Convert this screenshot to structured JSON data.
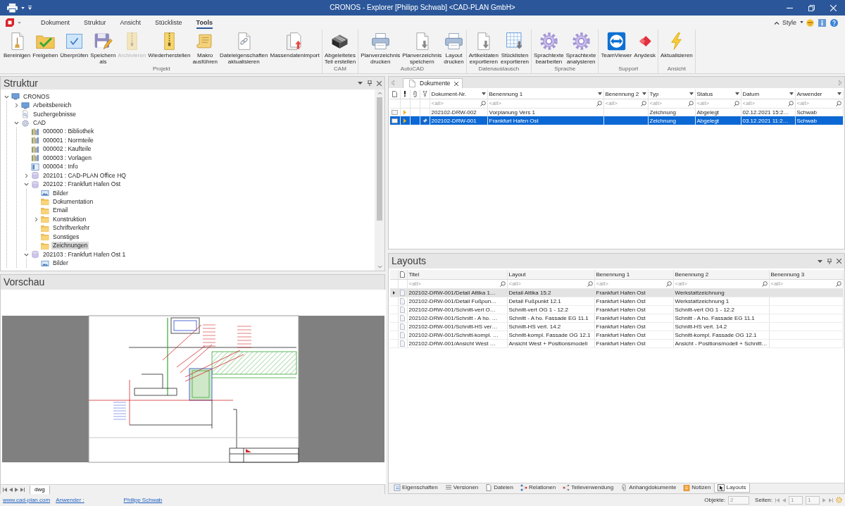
{
  "window": {
    "title": "CRONOS - Explorer [Philipp Schwab] <CAD-PLAN GmbH>"
  },
  "ribbon": {
    "tabs": [
      {
        "label": "Dokument",
        "selected": false
      },
      {
        "label": "Struktur",
        "selected": false
      },
      {
        "label": "Ansicht",
        "selected": false
      },
      {
        "label": "Stückliste",
        "selected": false
      },
      {
        "label": "Tools",
        "selected": true
      }
    ],
    "style_label": "Style",
    "groups": [
      {
        "label": "Projekt",
        "buttons": [
          {
            "label": "Bereinigen",
            "disabled": false
          },
          {
            "label": "Freigeben",
            "disabled": false
          },
          {
            "label": "Überprüfen",
            "disabled": false
          },
          {
            "label": "Speichern\nals",
            "disabled": false
          },
          {
            "label": "Archivieren",
            "disabled": true
          },
          {
            "label": "Wiederherstellen",
            "disabled": false
          },
          {
            "label": "Makro\nausführen",
            "disabled": false
          },
          {
            "label": "Dateieigenschaften\naktualisieren",
            "disabled": false
          },
          {
            "label": "Massendatenimport",
            "disabled": false
          }
        ]
      },
      {
        "label": "CAM",
        "buttons": [
          {
            "label": "Abgeleitetes\nTeil erstellen",
            "disabled": false
          }
        ]
      },
      {
        "label": "AutoCAD",
        "buttons": [
          {
            "label": "Planverzeichnis\ndrucken",
            "disabled": false
          },
          {
            "label": "Planverzeichnis\nspeichern",
            "disabled": false
          },
          {
            "label": "Layout\ndrucken",
            "disabled": false
          }
        ]
      },
      {
        "label": "Datenaustausch",
        "buttons": [
          {
            "label": "Artikeldaten\nexportieren",
            "disabled": false
          },
          {
            "label": "Stücklisten\nexportieren",
            "disabled": false
          }
        ]
      },
      {
        "label": "Sprache",
        "buttons": [
          {
            "label": "Sprachtexte\nbearbeiten",
            "disabled": false
          },
          {
            "label": "Sprachtexte\nanalysieren",
            "disabled": false
          }
        ]
      },
      {
        "label": "Support",
        "buttons": [
          {
            "label": "TeamViewer",
            "disabled": false
          },
          {
            "label": "Anydesk",
            "disabled": false
          }
        ]
      },
      {
        "label": "Ansicht",
        "buttons": [
          {
            "label": "Aktualisieren",
            "disabled": false
          }
        ]
      }
    ]
  },
  "structure": {
    "title": "Struktur",
    "tree": [
      {
        "label": "CRONOS",
        "kind": "root",
        "expanded": true,
        "selected": false,
        "children": [
          {
            "label": "Arbeitsbereich",
            "kind": "workspace",
            "expanded": false,
            "selected": false
          },
          {
            "label": "Suchergebnisse",
            "kind": "search",
            "selected": false
          },
          {
            "label": "CAD",
            "kind": "cad",
            "expanded": true,
            "selected": false,
            "children": [
              {
                "label": "000000 : Bibliothek",
                "kind": "library",
                "selected": false
              },
              {
                "label": "000001 : Normteile",
                "kind": "library",
                "selected": false
              },
              {
                "label": "000002 : Kaufteile",
                "kind": "library",
                "selected": false
              },
              {
                "label": "000003 : Vorlagen",
                "kind": "library",
                "selected": false
              },
              {
                "label": "000004 : Info",
                "kind": "info",
                "selected": false
              },
              {
                "label": "202101 : CAD-PLAN Office HQ",
                "kind": "project",
                "expanded": false,
                "selected": false
              },
              {
                "label": "202102 : Frankfurt Hafen Ost",
                "kind": "project",
                "expanded": true,
                "selected": false,
                "children": [
                  {
                    "label": "Bilder",
                    "kind": "images",
                    "selected": false
                  },
                  {
                    "label": "Dokumentation",
                    "kind": "folder",
                    "selected": false
                  },
                  {
                    "label": "Email",
                    "kind": "folder",
                    "selected": false
                  },
                  {
                    "label": "Konstruktion",
                    "kind": "folder",
                    "expanded": false,
                    "selected": false
                  },
                  {
                    "label": "Schriftverkehr",
                    "kind": "folder",
                    "selected": false
                  },
                  {
                    "label": "Sonstiges",
                    "kind": "folder",
                    "selected": false
                  },
                  {
                    "label": "Zeichnungen",
                    "kind": "folder",
                    "selected": true
                  }
                ]
              },
              {
                "label": "202103 : Frankfurt Hafen Ost 1",
                "kind": "project",
                "expanded": true,
                "selected": false,
                "children": [
                  {
                    "label": "Bilder",
                    "kind": "images",
                    "selected": false
                  }
                ]
              }
            ]
          }
        ]
      }
    ]
  },
  "preview": {
    "title": "Vorschau",
    "sheet_tabs": [
      {
        "label": "dwg",
        "selected": true
      }
    ]
  },
  "documents": {
    "tab": "Dokumente",
    "columns": [
      "Dokument-Nr.",
      "Benennung 1",
      "Benennung 2",
      "Typ",
      "Status",
      "Datum",
      "Anwender"
    ],
    "filters": [
      {
        "placeholder": "<all>"
      },
      {
        "placeholder": "<all>"
      },
      {
        "placeholder": "<all>"
      },
      {
        "placeholder": "<all>"
      },
      {
        "placeholder": "<all>"
      },
      {
        "placeholder": "<all>"
      },
      {
        "placeholder": "<all>"
      }
    ],
    "rows": [
      {
        "cells": [
          "202102-DRW-002",
          "Vorplanung Vers 1",
          null,
          "Zeichnung",
          "Abgelegt",
          "02.12.2021 15:2…",
          "Schwab"
        ],
        "pinned": false,
        "selected": false
      },
      {
        "cells": [
          "202102-DRW-001",
          "Frankfurt Hafen Ost",
          null,
          "Zeichnung",
          "Abgelegt",
          "03.12.2021 11:2…",
          "Schwab"
        ],
        "pinned": true,
        "selected": true
      }
    ]
  },
  "layouts": {
    "title": "Layouts",
    "columns": [
      "Titel",
      "Layout",
      "Benennung 1",
      "Benennung 2",
      "Benennung 3"
    ],
    "filters": [
      {
        "placeholder": "<all>"
      },
      {
        "placeholder": "<all>"
      },
      {
        "placeholder": "<all>"
      },
      {
        "placeholder": "<all>"
      },
      {
        "placeholder": "<all>"
      }
    ],
    "rows": [
      {
        "cells": [
          "202102-DRW-001/Detail Attika 1…",
          "Detail Attika 15.2",
          "Frankfurt Hafen Ost",
          "Werkstattzeichnung",
          null
        ],
        "selected": true
      },
      {
        "cells": [
          "202102-DRW-001/Detail Fußpun…",
          "Detail Fußpunkt 12.1",
          "Frankfurt Hafen Ost",
          "Werkstattzeichnung 1",
          null
        ],
        "selected": false
      },
      {
        "cells": [
          "202102-DRW-001/Schnitt-vert O…",
          "Schnitt-vert OG 1 - 12.2",
          "Frankfurt Hafen Ost",
          "Schnitt-vert OG 1 - 12.2",
          null
        ],
        "selected": false
      },
      {
        "cells": [
          "202102-DRW-001/Schnitt - A ho. …",
          "Schnitt - A ho. Fassade EG 11.1",
          "Frankfurt Hafen Ost",
          "Schnitt - A ho. Fassade EG 11.1",
          null
        ],
        "selected": false
      },
      {
        "cells": [
          "202102-DRW-001/Schnitt-HS ver…",
          "Schnitt-HS vert. 14.2",
          "Frankfurt Hafen Ost",
          "Schnitt-HS vert. 14.2",
          null
        ],
        "selected": false
      },
      {
        "cells": [
          "202102-DRW-001/Schnitt-kompl. …",
          "Schnitt-kompl. Fassade OG 12.1",
          "Frankfurt Hafen Ost",
          "Schnitt-kompl. Fassade OG 12.1",
          null
        ],
        "selected": false
      },
      {
        "cells": [
          "202102-DRW-001/Ansicht West …",
          "Ansicht West + Positionsmodell",
          "Frankfurt Hafen Ost",
          "Ansicht - Positionsmodell + Schnitt…",
          null
        ],
        "selected": false
      }
    ],
    "tabs": [
      {
        "label": "Eigenschaften",
        "selected": false
      },
      {
        "label": "Versionen",
        "selected": false
      },
      {
        "label": "Dateien",
        "selected": false
      },
      {
        "label": "Relationen",
        "selected": false
      },
      {
        "label": "Teileverwendung",
        "selected": false
      },
      {
        "label": "Anhangdokumente",
        "selected": false
      },
      {
        "label": "Notizen",
        "selected": false
      },
      {
        "label": "Layouts",
        "selected": true
      }
    ]
  },
  "status_bar": {
    "website": "www.cad-plan.com",
    "user_label": "Anwender :",
    "user": "Philipp Schwab",
    "objects_label": "Objekte:",
    "objects": "2",
    "pages_label": "Seiten:",
    "page": "1",
    "page_count": "1"
  }
}
